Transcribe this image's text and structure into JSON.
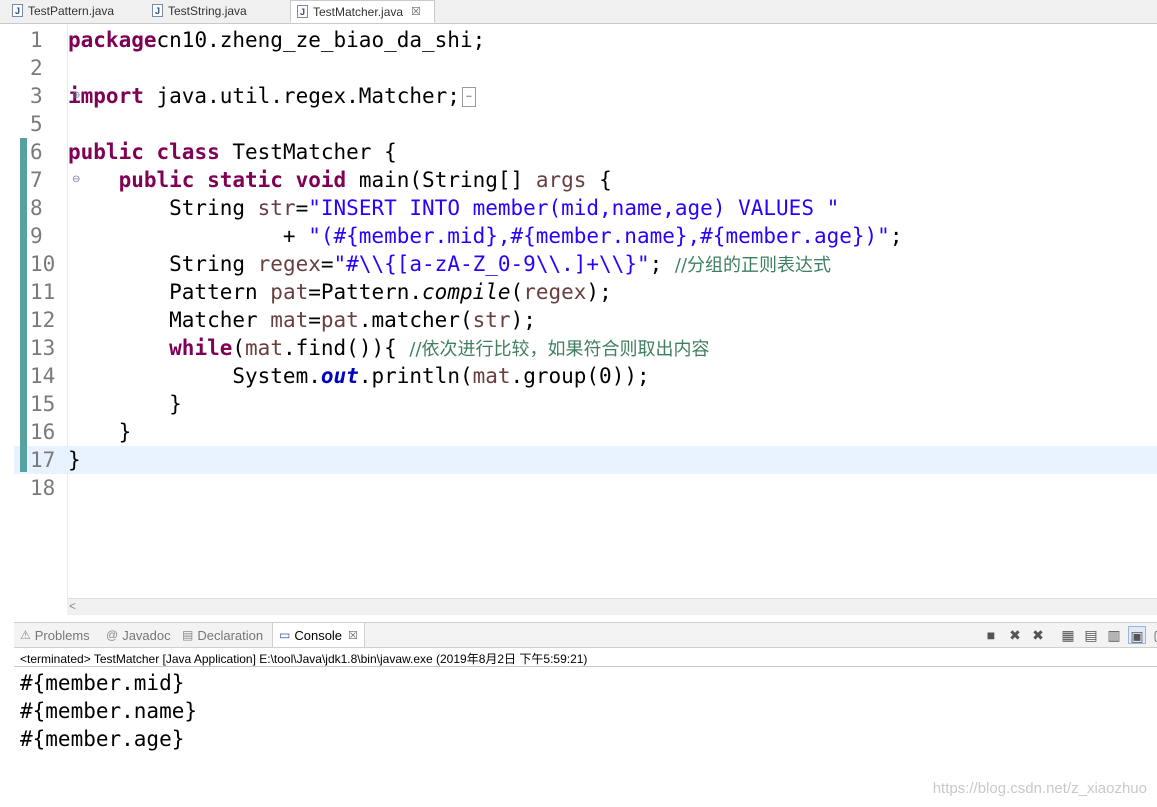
{
  "editor_tabs": [
    {
      "label": "TestPattern.java",
      "active": false
    },
    {
      "label": "TestString.java",
      "active": false
    },
    {
      "label": "TestMatcher.java",
      "active": true
    }
  ],
  "tab_close_glyph": "☒",
  "code_lines": [
    {
      "num": "1",
      "tokens": [
        [
          "kw",
          "package"
        ],
        [
          "",
          "cn10.zheng_ze_biao_da_shi;"
        ]
      ]
    },
    {
      "num": "2",
      "tokens": []
    },
    {
      "num": "3",
      "tokens": [
        [
          "kw",
          "import"
        ],
        [
          "",
          " java.util.regex.Matcher;"
        ]
      ]
    },
    {
      "num": "5",
      "tokens": []
    },
    {
      "num": "6",
      "tokens": [
        [
          "kw",
          "public"
        ],
        [
          "",
          " "
        ],
        [
          "kw",
          "class"
        ],
        [
          "",
          " TestMatcher {"
        ]
      ]
    },
    {
      "num": "7",
      "tokens": [
        [
          "",
          " "
        ],
        [
          "kw",
          "public"
        ],
        [
          "",
          " "
        ],
        [
          "kw",
          "static"
        ],
        [
          "",
          " "
        ],
        [
          "kw",
          "void"
        ],
        [
          "",
          " main(String[] "
        ],
        [
          "var",
          "args"
        ],
        [
          "",
          " {"
        ]
      ]
    },
    {
      "num": "8",
      "tokens": [
        [
          "",
          " String "
        ],
        [
          "var",
          "str"
        ],
        [
          "",
          "="
        ],
        [
          "str",
          "\"INSERT INTO member(mid,name,age) VALUES \""
        ]
      ]
    },
    {
      "num": "9",
      "tokens": [
        [
          "",
          " + "
        ],
        [
          "str",
          "\"(#{member.mid},#{member.name},#{member.age})\""
        ],
        [
          "",
          ";"
        ]
      ]
    },
    {
      "num": "10",
      "tokens": [
        [
          "",
          " String "
        ],
        [
          "var",
          "regex"
        ],
        [
          "",
          "="
        ],
        [
          "str",
          "\"#\\\\{[a-zA-Z_0-9\\\\.]+\\\\}\""
        ],
        [
          "",
          "; "
        ],
        [
          "cmt",
          "//分组的正则表达式"
        ]
      ]
    },
    {
      "num": "11",
      "tokens": [
        [
          "",
          " Pattern "
        ],
        [
          "var",
          "pat"
        ],
        [
          "",
          "=Pattern."
        ],
        [
          "ital",
          "compile"
        ],
        [
          "",
          "("
        ],
        [
          "var",
          "regex"
        ],
        [
          "",
          ");"
        ]
      ]
    },
    {
      "num": "12",
      "tokens": [
        [
          "",
          " Matcher "
        ],
        [
          "var",
          "mat"
        ],
        [
          "",
          "="
        ],
        [
          "var",
          "pat"
        ],
        [
          "",
          ".matcher("
        ],
        [
          "var",
          "str"
        ],
        [
          "",
          ");"
        ]
      ]
    },
    {
      "num": "13",
      "tokens": [
        [
          "",
          " "
        ],
        [
          "kw",
          "while"
        ],
        [
          "",
          "("
        ],
        [
          "var",
          "mat"
        ],
        [
          "",
          ".find()){ "
        ],
        [
          "cmt",
          "//依次进行比较，如果符合则取出内容"
        ]
      ]
    },
    {
      "num": "14",
      "tokens": [
        [
          "",
          " System."
        ],
        [
          "fld",
          "out"
        ],
        [
          "",
          ".println("
        ],
        [
          "var",
          "mat"
        ],
        [
          "",
          ".group(0));"
        ]
      ]
    },
    {
      "num": "15",
      "tokens": [
        [
          "",
          " }"
        ]
      ]
    },
    {
      "num": "16",
      "tokens": [
        [
          "",
          " }"
        ]
      ]
    },
    {
      "num": "17",
      "tokens": [
        [
          "",
          "}"
        ]
      ]
    },
    {
      "num": "18",
      "tokens": []
    }
  ],
  "panel_tabs": [
    {
      "label": "Problems",
      "icon": "problems-icon",
      "active": false
    },
    {
      "label": "Javadoc",
      "icon": "at-icon",
      "active": false
    },
    {
      "label": "Declaration",
      "icon": "declaration-icon",
      "active": false
    },
    {
      "label": "Console",
      "icon": "console-icon",
      "active": true
    }
  ],
  "console": {
    "status": "<terminated> TestMatcher [Java Application] E:\\tool\\Java\\jdk1.8\\bin\\javaw.exe (2019年8月2日 下午5:59:21)",
    "output": [
      "#{member.mid}",
      "#{member.name}",
      "#{member.age}"
    ]
  },
  "watermark": "https://blog.csdn.net/z_xiaozhuo"
}
